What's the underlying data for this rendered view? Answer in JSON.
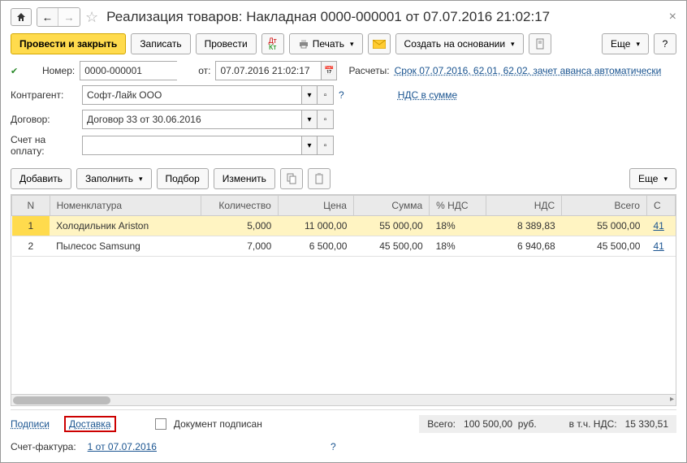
{
  "title": "Реализация товаров: Накладная 0000-000001 от 07.07.2016 21:02:17",
  "toolbar": {
    "post_close": "Провести и закрыть",
    "write": "Записать",
    "post": "Провести",
    "print": "Печать",
    "create_based": "Создать на основании",
    "more": "Еще"
  },
  "form": {
    "number_label": "Номер:",
    "number": "0000-000001",
    "date_label": "от:",
    "date": "07.07.2016 21:02:17",
    "settlements_label": "Расчеты:",
    "settlements": "Срок 07.07.2016, 62.01, 62.02, зачет аванса автоматически",
    "contragent_label": "Контрагент:",
    "contragent": "Софт-Лайк ООО",
    "vat_in_sum": "НДС в сумме",
    "contract_label": "Договор:",
    "contract": "Договор 33 от 30.06.2016",
    "invoice_label": "Счет на оплату:"
  },
  "table_toolbar": {
    "add": "Добавить",
    "fill": "Заполнить",
    "select": "Подбор",
    "change": "Изменить",
    "more": "Еще"
  },
  "columns": {
    "n": "N",
    "item": "Номенклатура",
    "qty": "Количество",
    "price": "Цена",
    "sum": "Сумма",
    "vat_pct": "% НДС",
    "vat": "НДС",
    "total": "Всего",
    "last": "С"
  },
  "rows": [
    {
      "n": "1",
      "item": "Холодильник Ariston",
      "qty": "5,000",
      "price": "11 000,00",
      "sum": "55 000,00",
      "vat_pct": "18%",
      "vat": "8 389,83",
      "total": "55 000,00",
      "link": "41"
    },
    {
      "n": "2",
      "item": "Пылесос Samsung",
      "qty": "7,000",
      "price": "6 500,00",
      "sum": "45 500,00",
      "vat_pct": "18%",
      "vat": "6 940,68",
      "total": "45 500,00",
      "link": "41"
    }
  ],
  "footer": {
    "signatures": "Подписи",
    "delivery": "Доставка",
    "doc_signed": "Документ подписан",
    "total_label": "Всего:",
    "total": "100 500,00",
    "currency": "руб.",
    "vat_incl_label": "в т.ч. НДС:",
    "vat_incl": "15 330,51",
    "invoice_label": "Счет-фактура:",
    "invoice_link": "1 от 07.07.2016"
  }
}
